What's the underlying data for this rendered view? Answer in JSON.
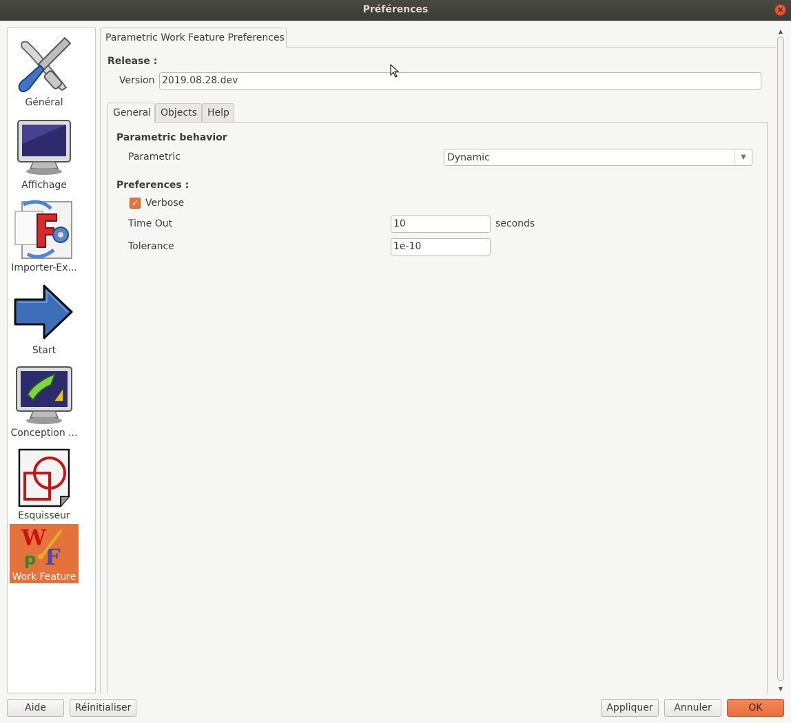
{
  "window": {
    "title": "Préférences"
  },
  "sidebar": {
    "items": [
      {
        "label": "Général",
        "icon": "tools-icon"
      },
      {
        "label": "Affichage",
        "icon": "monitor-icon"
      },
      {
        "label": "Importer-Ex...",
        "icon": "import-export-icon"
      },
      {
        "label": "Start",
        "icon": "arrow-right-icon"
      },
      {
        "label": "Conception ...",
        "icon": "part-design-icon"
      },
      {
        "label": "Esquisseur",
        "icon": "sketcher-icon"
      },
      {
        "label": "Work Feature",
        "icon": "work-feature-icon",
        "selected": true
      }
    ]
  },
  "main": {
    "tab_label": "Parametric Work Feature Preferences",
    "release": {
      "title": "Release :",
      "version_label": "Version",
      "version_value": "2019.08.28.dev"
    },
    "tabs": [
      "General",
      "Objects",
      "Help"
    ],
    "active_tab": "General",
    "parametric_group": {
      "title": "Parametric behavior",
      "parametric_label": "Parametric",
      "parametric_value": "Dynamic"
    },
    "preferences_group": {
      "title": "Preferences :",
      "verbose_label": "Verbose",
      "verbose_checked": true,
      "timeout_label": "Time Out",
      "timeout_value": "10",
      "timeout_unit": "seconds",
      "tolerance_label": "Tolerance",
      "tolerance_value": "1e-10"
    }
  },
  "buttons": {
    "help": "Aide",
    "reset": "Réinitialiser",
    "apply": "Appliquer",
    "cancel": "Annuler",
    "ok": "OK"
  },
  "colors": {
    "accent": "#e5713b",
    "titlebar": "#3b3b37"
  }
}
